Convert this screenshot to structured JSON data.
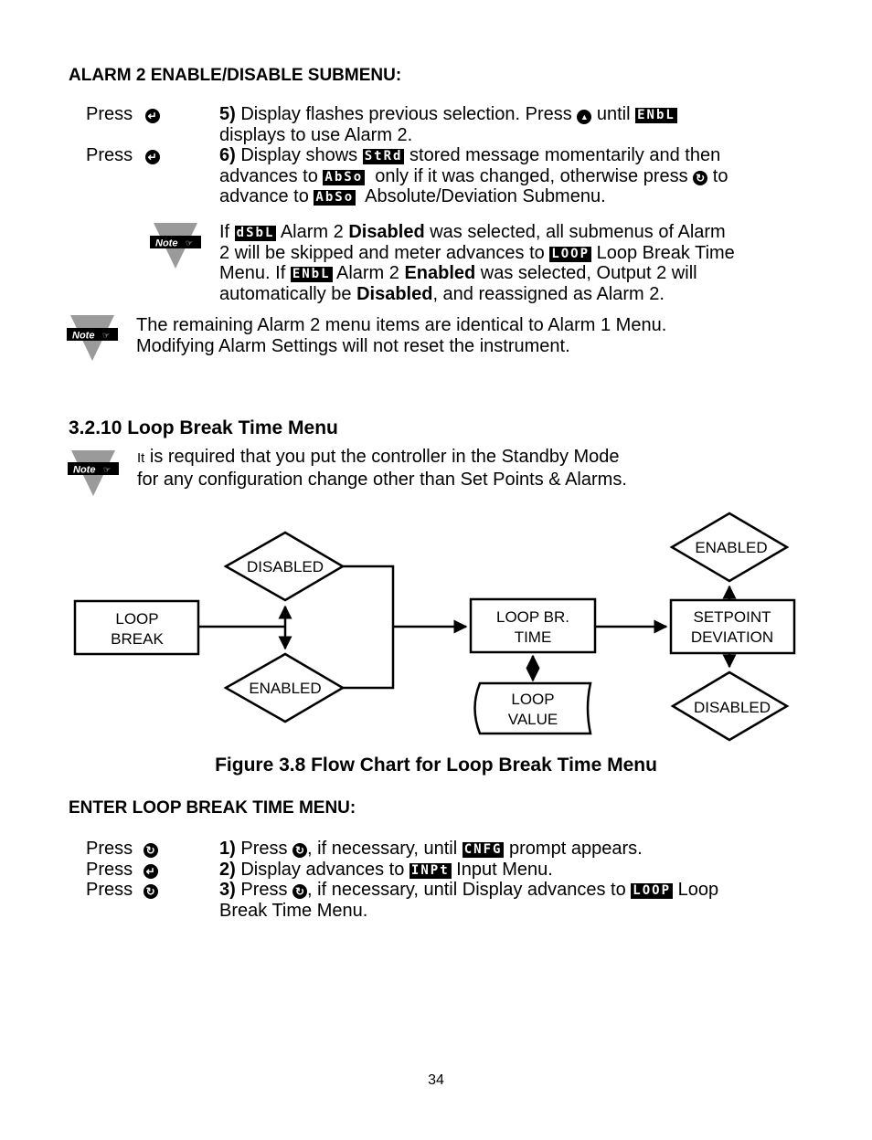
{
  "alarm2": {
    "heading": "ALARM 2 ENABLE/DISABLE SUBMENU:",
    "steps": [
      {
        "press": "Press",
        "button": "enter-button",
        "num": "5)",
        "t1": " Display flashes previous selection. Press ",
        "t2": " until ",
        "lcd1": "ENbL",
        "line2": "displays to use Alarm 2."
      },
      {
        "press": "Press",
        "button": "enter-button",
        "num": "6)",
        "t1": " Display shows ",
        "lcd1": "StRd",
        "t2": " stored message momentarily and then",
        "line2a": "advances to ",
        "lcd2": "AbSo",
        "line2b": "  only if it was changed, otherwise press ",
        "line2c": " to",
        "line3a": "advance to ",
        "lcd3": "AbSo",
        "line3b": "  Absolute/Deviation Submenu."
      }
    ],
    "note1": {
      "label": "Note",
      "p1": "If ",
      "lcd1": "dSbL",
      "p2": " Alarm 2 ",
      "b1": "Disabled",
      "p3": " was selected, all submenus of Alarm",
      "p4": "2 will be skipped and meter advances to ",
      "lcd2": "LOOP",
      "p5": " Loop Break Time",
      "p6": "Menu. If ",
      "lcd3": "ENbL",
      "p7": " Alarm 2 ",
      "b2": "Enabled",
      "p8": " was selected, Output 2 will",
      "p9": "automatically be ",
      "b3": "Disabled",
      "p10": ", and reassigned as Alarm 2."
    },
    "note2": {
      "label": "Note",
      "line1": "The remaining Alarm 2 menu items are identical to Alarm 1 Menu.",
      "line2": "Modifying Alarm Settings will not reset the instrument."
    }
  },
  "section": {
    "heading": "3.2.10 Loop Break Time Menu",
    "note": {
      "label": "Note",
      "lead": "It",
      "line1": " is required that you put the controller in the Standby Mode",
      "line2": "for any configuration change other than Set Points & Alarms."
    }
  },
  "flowchart": {
    "nodes": {
      "loop_break": [
        "LOOP",
        "BREAK"
      ],
      "disabled_left": "DISABLED",
      "enabled_left": "ENABLED",
      "loop_br_time": [
        "LOOP BR.",
        "TIME"
      ],
      "loop_value": [
        "LOOP",
        "VALUE"
      ],
      "setpoint_deviation": [
        "SETPOINT",
        "DEVIATION"
      ],
      "enabled_right": "ENABLED",
      "disabled_right": "DISABLED"
    },
    "caption": "Figure 3.8 Flow Chart for Loop Break Time Menu"
  },
  "enter_menu": {
    "heading": "ENTER LOOP BREAK TIME MENU:",
    "steps": [
      {
        "press": "Press",
        "button": "menu-button",
        "num": "1)",
        "t1": " Press ",
        "t2": ", if necessary, until ",
        "lcd": "CNFG",
        "t3": " prompt appears."
      },
      {
        "press": "Press",
        "button": "enter-button",
        "num": "2)",
        "t1": " Display advances to ",
        "lcd": "INPt",
        "t3": " Input Menu."
      },
      {
        "press": "Press",
        "button": "menu-button",
        "num": "3)",
        "t1": " Press ",
        "t2": ", if necessary, until Display advances to ",
        "lcd": "LOOP",
        "t3": " Loop",
        "line2": "Break Time Menu."
      }
    ]
  },
  "page_number": "34",
  "icons": {
    "enter": "↵",
    "menu": "↻",
    "up": "▲"
  }
}
